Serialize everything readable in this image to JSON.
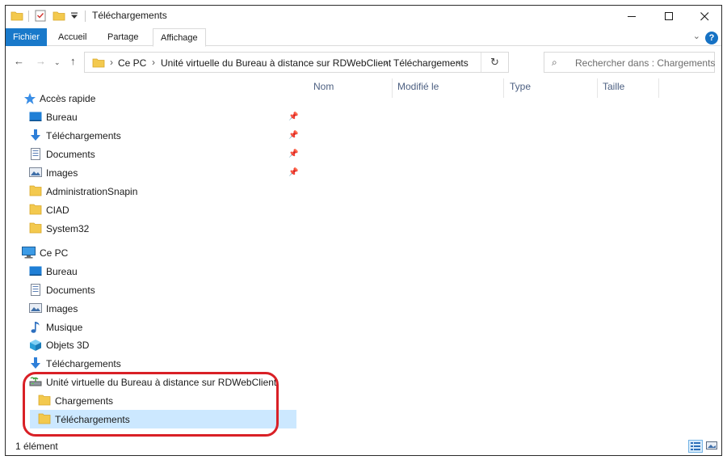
{
  "window": {
    "title": "Téléchargements",
    "minimize_glyph": "—",
    "maximize_glyph": "☐",
    "close_glyph": "✕"
  },
  "ribbon": {
    "tabs": [
      {
        "label": "Fichier"
      },
      {
        "label": "Accueil"
      },
      {
        "label": "Partage"
      },
      {
        "label": "Affichage"
      }
    ],
    "help_glyph": "?",
    "expand_glyph": "⌄"
  },
  "navigation": {
    "back_glyph": "←",
    "forward_glyph": "→",
    "recent_glyph": "⌄",
    "up_glyph": "↑"
  },
  "address": {
    "crumbs": [
      "Ce PC",
      "Unité virtuelle du Bureau à distance sur RDWebClient",
      "Téléchargements"
    ],
    "separator": "›",
    "dropdown_glyph": "⌄",
    "refresh_glyph": "↻"
  },
  "search": {
    "placeholder": "Rechercher dans : Chargements",
    "icon_glyph": "⌕"
  },
  "nav_pane": {
    "quick_access": {
      "label": "Accès rapide",
      "items": [
        {
          "label": "Bureau",
          "icon": "desktop-icon",
          "pinned": true
        },
        {
          "label": "Téléchargements",
          "icon": "download-icon",
          "pinned": true
        },
        {
          "label": "Documents",
          "icon": "document-icon",
          "pinned": true
        },
        {
          "label": "Images",
          "icon": "pictures-icon",
          "pinned": true
        },
        {
          "label": "AdministrationSnapin",
          "icon": "folder-icon",
          "pinned": false
        },
        {
          "label": "CIAD",
          "icon": "folder-icon",
          "pinned": false
        },
        {
          "label": "System32",
          "icon": "folder-icon",
          "pinned": false
        }
      ]
    },
    "this_pc": {
      "label": "Ce PC",
      "items": [
        {
          "label": "Bureau",
          "icon": "desktop-icon"
        },
        {
          "label": "Documents",
          "icon": "document-icon"
        },
        {
          "label": "Images",
          "icon": "pictures-icon"
        },
        {
          "label": "Musique",
          "icon": "music-icon"
        },
        {
          "label": "Objets 3D",
          "icon": "3d-objects-icon"
        },
        {
          "label": "Téléchargements",
          "icon": "download-icon"
        },
        {
          "label": "Unité virtuelle du Bureau à distance sur RDWebClient",
          "icon": "network-drive-icon"
        }
      ]
    },
    "drive_children": [
      {
        "label": "Chargements",
        "icon": "folder-icon"
      },
      {
        "label": "Téléchargements",
        "icon": "folder-icon",
        "selected": true
      }
    ],
    "pin_glyph": "📌"
  },
  "content": {
    "columns": [
      "Nom",
      "Modifié le",
      "Type",
      "Taille"
    ]
  },
  "status": {
    "item_count": "1 élément"
  },
  "colors": {
    "accent": "#1979ca",
    "selection": "#cce8ff",
    "highlight_ring": "#d92026",
    "folder": "#f3c94e"
  }
}
